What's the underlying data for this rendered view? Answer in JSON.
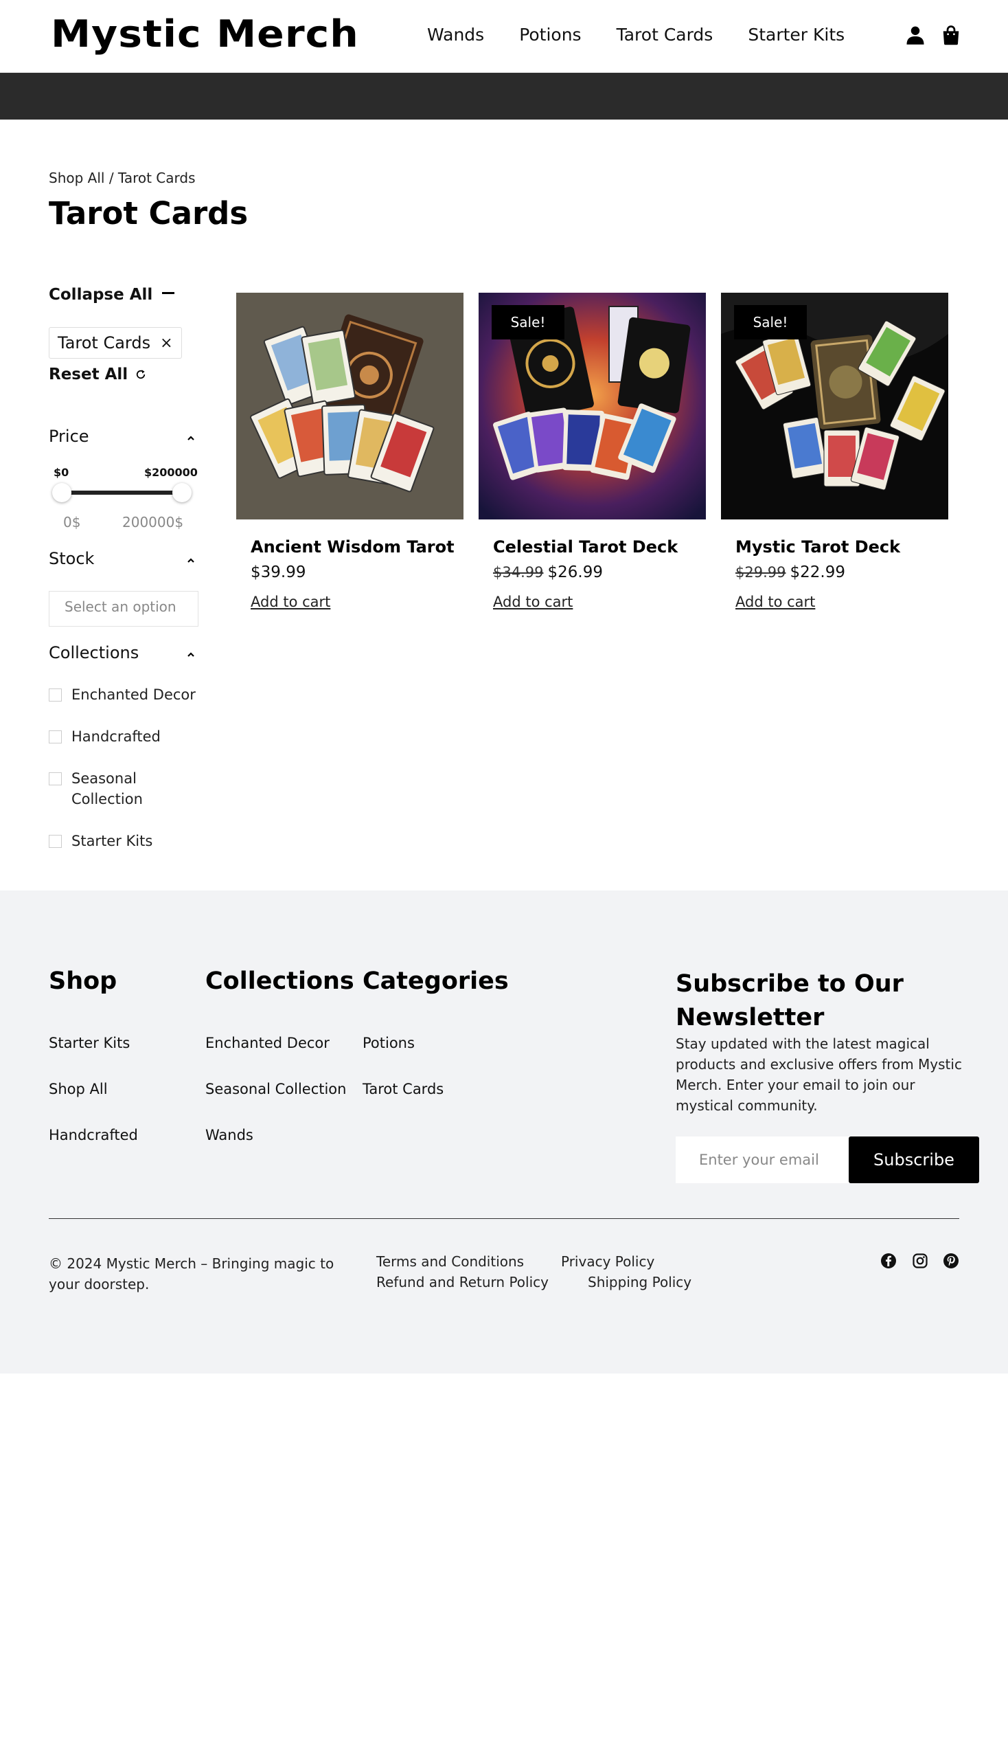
{
  "brand": {
    "logo": "Mystic Merch"
  },
  "nav": {
    "items": [
      "Wands",
      "Potions",
      "Tarot Cards",
      "Starter Kits"
    ]
  },
  "icons": {
    "account": "user-icon",
    "cart": "shopping-bag-icon"
  },
  "breadcrumb": "Shop All / Tarot Cards",
  "page_title": "Tarot Cards",
  "filters": {
    "collapse_all": "Collapse All",
    "active_chip": "Tarot Cards",
    "chip_remove": "×",
    "reset_all": "Reset All",
    "price": {
      "title": "Price",
      "min_label": "$0",
      "max_label": "$200000",
      "min_value": "0$",
      "max_value": "200000$"
    },
    "stock": {
      "title": "Stock",
      "placeholder": "Select an option"
    },
    "collections": {
      "title": "Collections",
      "options": [
        "Enchanted Decor",
        "Handcrafted",
        "Seasonal Collection",
        "Starter Kits"
      ]
    }
  },
  "products": [
    {
      "name": "Ancient Wisdom Tarot",
      "price": "$39.99",
      "old_price": "",
      "sale_badge": "",
      "cta": "Add to cart"
    },
    {
      "name": "Celestial Tarot Deck",
      "price": "$26.99",
      "old_price": "$34.99",
      "sale_badge": "Sale!",
      "cta": "Add to cart"
    },
    {
      "name": "Mystic Tarot Deck",
      "price": "$22.99",
      "old_price": "$29.99",
      "sale_badge": "Sale!",
      "cta": "Add to cart"
    }
  ],
  "footer": {
    "shop": {
      "title": "Shop",
      "links": [
        "Starter Kits",
        "Shop All",
        "Handcrafted"
      ]
    },
    "collections": {
      "title": "Collections",
      "links": [
        "Enchanted Decor",
        "Seasonal Collection",
        "Wands"
      ]
    },
    "categories": {
      "title": "Categories",
      "links": [
        "Potions",
        "Tarot Cards"
      ]
    },
    "newsletter": {
      "title": "Subscribe to Our Newsletter",
      "text": "Stay updated with the latest magical products and exclusive offers from Mystic Merch. Enter your email to join our mystical community.",
      "placeholder": "Enter your email",
      "button": "Subscribe"
    },
    "copyright": "© 2024 Mystic Merch – Bringing magic to your doorstep.",
    "legal": [
      "Terms and Conditions",
      "Privacy Policy",
      "Refund and Return Policy",
      "Shipping Policy"
    ],
    "social": [
      "facebook-icon",
      "instagram-icon",
      "pinterest-icon"
    ]
  },
  "colors": {
    "announcement_bar": "#2b2b2b",
    "footer_bg": "#f2f3f5",
    "button": "#000000"
  }
}
